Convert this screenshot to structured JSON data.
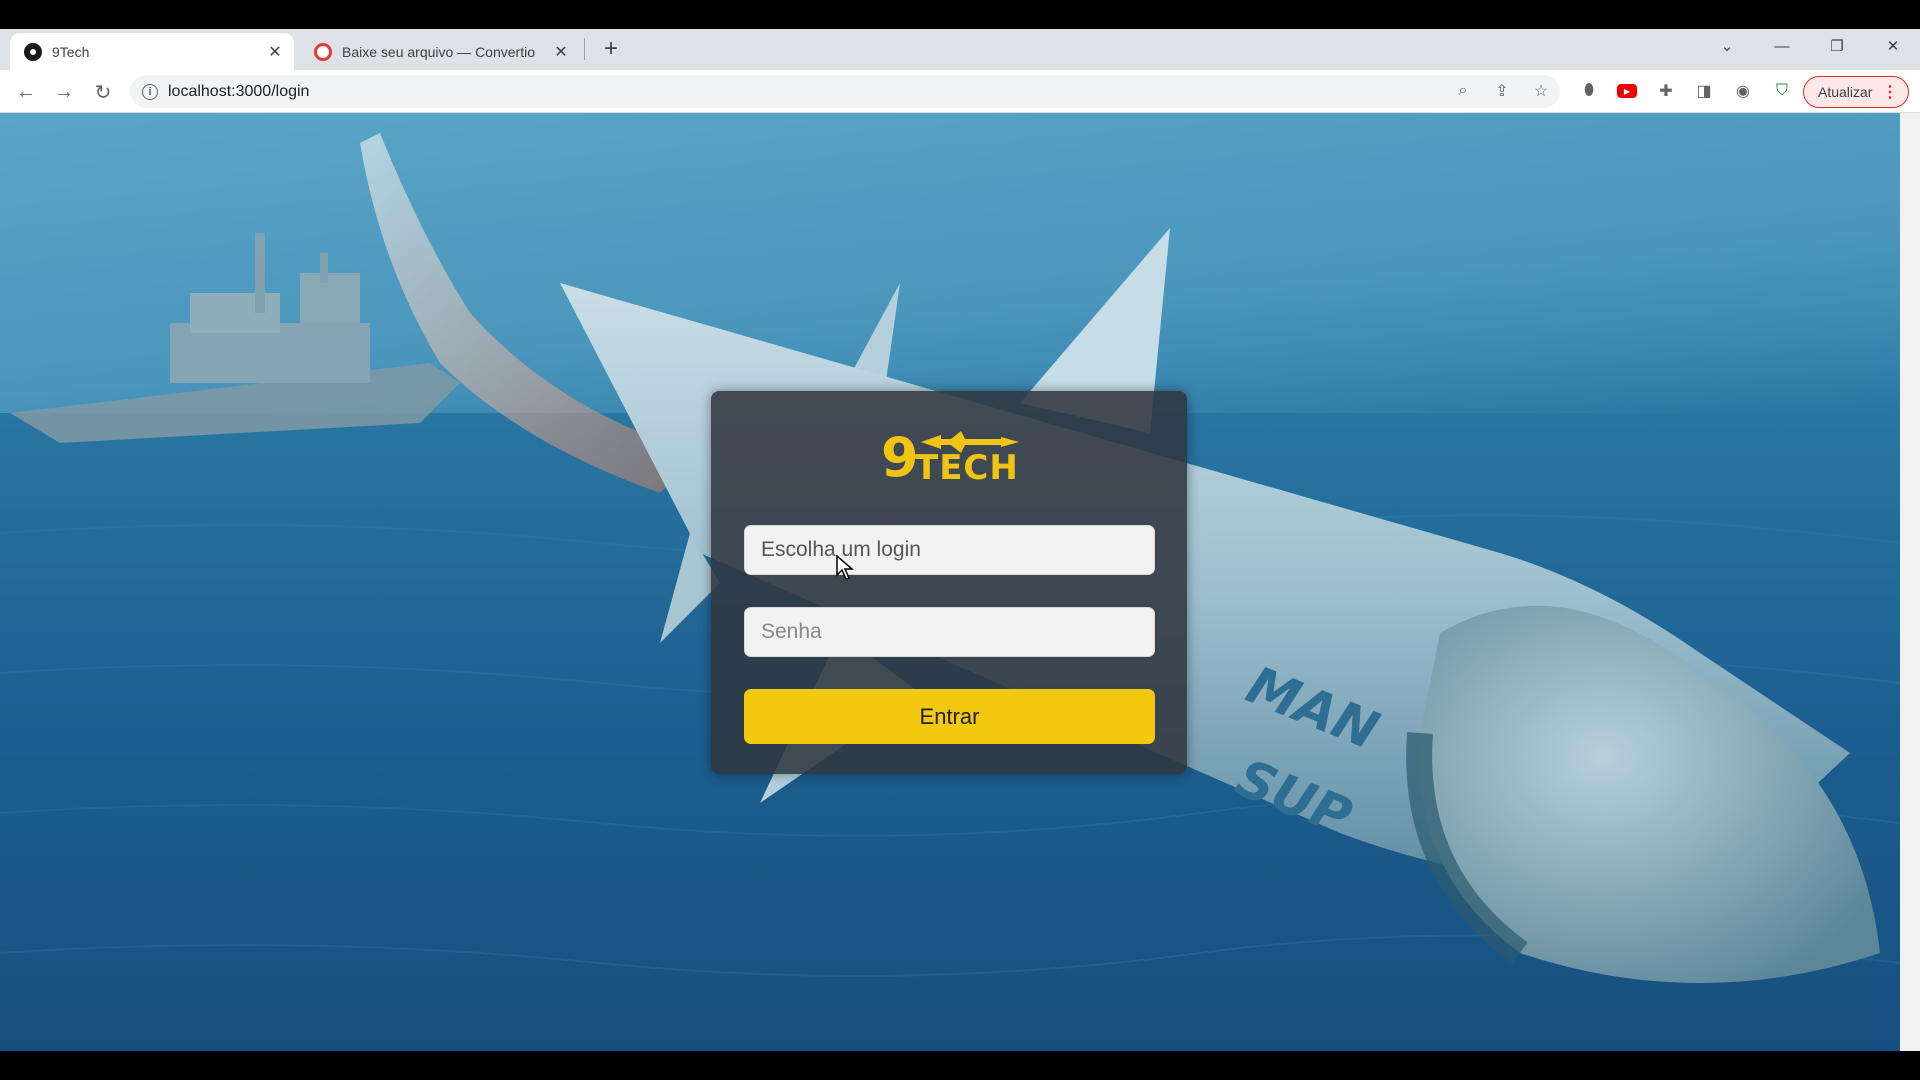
{
  "browser": {
    "tabs": [
      {
        "title": "9Tech",
        "active": true
      },
      {
        "title": "Baixe seu arquivo — Convertio",
        "active": false
      }
    ],
    "url": "localhost:3000/login",
    "update_button": "Atualizar"
  },
  "login_form": {
    "logo_nine": "9",
    "logo_tech": "TECH",
    "login_placeholder": "Escolha um login",
    "password_placeholder": "Senha",
    "submit_label": "Entrar"
  },
  "colors": {
    "accent": "#f2c811",
    "card": "#303740"
  }
}
